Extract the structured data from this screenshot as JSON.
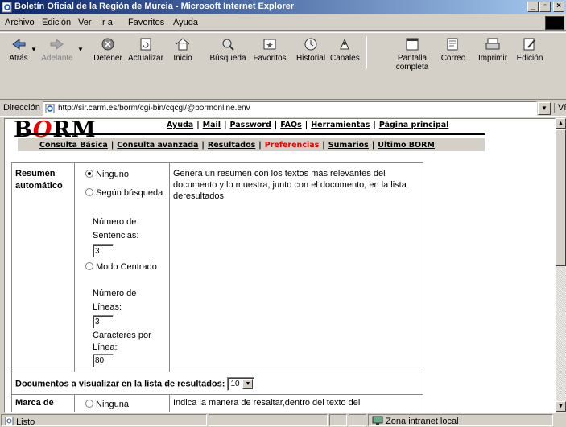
{
  "window": {
    "title": "Boletín Oficial de la Región de Murcia - Microsoft Internet Explorer",
    "buttons": {
      "min": "_",
      "max": "▫",
      "close": "×"
    }
  },
  "menu": [
    "Archivo",
    "Edición",
    "Ver",
    "Ir a",
    "Favoritos",
    "Ayuda"
  ],
  "toolbar": {
    "back": "Atrás",
    "forward": "Adelante",
    "stop": "Detener",
    "refresh": "Actualizar",
    "home": "Inicio",
    "search": "Búsqueda",
    "favorites": "Favoritos",
    "history": "Historial",
    "channels": "Canales",
    "fullscreen": "Pantalla completa",
    "mail": "Correo",
    "print": "Imprimir",
    "edit": "Edición"
  },
  "address": {
    "label": "Dirección",
    "url": "http://sir.carm.es/borm/cgi-bin/cqcgi/@bormonline.env",
    "links": "Vínculos"
  },
  "page": {
    "logo": {
      "pre": "B",
      "mid": "O",
      "post": "RM"
    },
    "toplinks": [
      "Ayuda",
      "Mail",
      "Password",
      "FAQs",
      "Herramientas",
      "Página principal"
    ],
    "nav": [
      "Consulta Básica",
      "Consulta avanzada",
      "Resultados",
      "Preferencias",
      "Sumarios",
      "Ultimo BORM"
    ],
    "active_nav": "Preferencias",
    "resumen": {
      "label": "Resumen automático",
      "opt_ninguno": "Ninguno",
      "opt_segun": "Según búsqueda",
      "num_sentencias_label": "Número de Sentencias:",
      "num_sentencias_value": "3",
      "opt_modo": "Modo Centrado",
      "num_lineas_label": "Número de Líneas:",
      "num_lineas_value": "3",
      "caracteres_label": "Caracteres por Línea:",
      "caracteres_value": "80",
      "description": "Genera un resumen con los textos más relevantes del documento y lo muestra, junto con el documento, en la lista deresultados."
    },
    "documentos": {
      "label": "Documentos a visualizar en la lista de resultados:",
      "value": "10"
    },
    "marca": {
      "label": "Marca de",
      "opt_ninguna": "Ninguna",
      "description": "Indica la manera de resaltar,dentro del texto del"
    }
  },
  "status": {
    "text": "Listo",
    "zone": "Zona intranet local"
  }
}
